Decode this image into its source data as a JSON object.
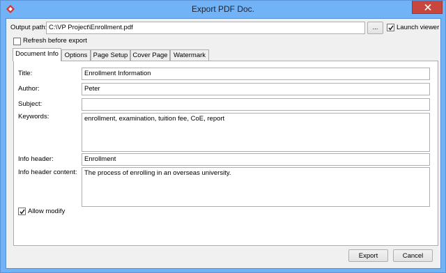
{
  "window": {
    "title": "Export PDF Doc."
  },
  "output": {
    "label": "Output path:",
    "value": "C:\\VP Project\\Enrollment.pdf",
    "browse_label": "...",
    "launch_viewer_label": "Launch viewer",
    "launch_viewer_checked": true,
    "refresh_label": "Refresh before export",
    "refresh_checked": false
  },
  "tabs": [
    {
      "label": "Document Info",
      "active": true
    },
    {
      "label": "Options",
      "active": false
    },
    {
      "label": "Page Setup",
      "active": false
    },
    {
      "label": "Cover Page",
      "active": false
    },
    {
      "label": "Watermark",
      "active": false
    }
  ],
  "doc_info": {
    "title_label": "Title:",
    "title_value": "Enrollment Information",
    "author_label": "Author:",
    "author_value": "Peter",
    "subject_label": "Subject:",
    "subject_value": "",
    "keywords_label": "Keywords:",
    "keywords_value": "enrollment, examination, tuition fee, CoE, report",
    "info_header_label": "Info header:",
    "info_header_value": "Enrollment",
    "info_header_content_label": "Info header content:",
    "info_header_content_value": "The process of enrolling in an overseas university.",
    "allow_modify_label": "Allow modify",
    "allow_modify_checked": true
  },
  "buttons": {
    "export": "Export",
    "cancel": "Cancel"
  }
}
